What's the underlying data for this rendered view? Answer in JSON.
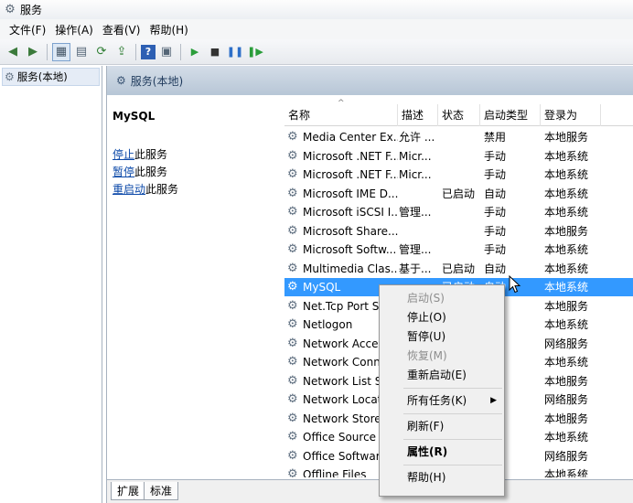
{
  "window": {
    "title": "服务"
  },
  "menubar": [
    {
      "name": "menu-file",
      "label": "文件(F)"
    },
    {
      "name": "menu-action",
      "label": "操作(A)"
    },
    {
      "name": "menu-view",
      "label": "查看(V)"
    },
    {
      "name": "menu-help",
      "label": "帮助(H)"
    }
  ],
  "tree": {
    "root": "服务(本地)"
  },
  "main": {
    "header": "服务(本地)",
    "selected_service": "MySQL",
    "actions": [
      {
        "link": "停止",
        "rest": "此服务"
      },
      {
        "link": "暂停",
        "rest": "此服务"
      },
      {
        "link": "重启动",
        "rest": "此服务"
      }
    ],
    "columns": [
      "名称",
      "描述",
      "状态",
      "启动类型",
      "登录为"
    ],
    "rows": [
      {
        "name": "Media Center Ex...",
        "desc": "允许 ...",
        "status": "",
        "startup": "禁用",
        "logon": "本地服务"
      },
      {
        "name": "Microsoft .NET F...",
        "desc": "Micr...",
        "status": "",
        "startup": "手动",
        "logon": "本地系统"
      },
      {
        "name": "Microsoft .NET F...",
        "desc": "Micr...",
        "status": "",
        "startup": "手动",
        "logon": "本地系统"
      },
      {
        "name": "Microsoft IME D...",
        "desc": "",
        "status": "已启动",
        "startup": "自动",
        "logon": "本地系统"
      },
      {
        "name": "Microsoft iSCSI I...",
        "desc": "管理...",
        "status": "",
        "startup": "手动",
        "logon": "本地系统"
      },
      {
        "name": "Microsoft Share...",
        "desc": "",
        "status": "",
        "startup": "手动",
        "logon": "本地服务"
      },
      {
        "name": "Microsoft Softw...",
        "desc": "管理...",
        "status": "",
        "startup": "手动",
        "logon": "本地系统"
      },
      {
        "name": "Multimedia Clas...",
        "desc": "基于...",
        "status": "已启动",
        "startup": "自动",
        "logon": "本地系统"
      },
      {
        "name": "MySQL",
        "desc": "",
        "status": "已启动",
        "startup": "自动",
        "logon": "本地系统"
      },
      {
        "name": "Net.Tcp Port Sh",
        "desc": "",
        "status": "",
        "startup": "",
        "logon": "本地服务"
      },
      {
        "name": "Netlogon",
        "desc": "",
        "status": "",
        "startup": "",
        "logon": "本地系统"
      },
      {
        "name": "Network Access",
        "desc": "",
        "status": "",
        "startup": "",
        "logon": "网络服务"
      },
      {
        "name": "Network Conne",
        "desc": "",
        "status": "",
        "startup": "",
        "logon": "本地系统"
      },
      {
        "name": "Network List Se",
        "desc": "",
        "status": "",
        "startup": "",
        "logon": "本地服务"
      },
      {
        "name": "Network Locati",
        "desc": "",
        "status": "",
        "startup": "",
        "logon": "网络服务"
      },
      {
        "name": "Network Store",
        "desc": "",
        "status": "",
        "startup": "",
        "logon": "本地服务"
      },
      {
        "name": "Office  Source",
        "desc": "",
        "status": "",
        "startup": "",
        "logon": "本地系统"
      },
      {
        "name": "Office Software",
        "desc": "",
        "status": "",
        "startup": "",
        "logon": "网络服务"
      },
      {
        "name": "Offline Files",
        "desc": "",
        "status": "",
        "startup": "",
        "logon": "本地系统"
      }
    ],
    "selected_row_index": 8,
    "tabs": [
      "扩展",
      "标准"
    ]
  },
  "context_menu": {
    "items": [
      {
        "label": "启动(S)",
        "disabled": true
      },
      {
        "label": "停止(O)"
      },
      {
        "label": "暂停(U)"
      },
      {
        "label": "恢复(M)",
        "disabled": true
      },
      {
        "label": "重新启动(E)"
      },
      {
        "separator": true
      },
      {
        "label": "所有任务(K)",
        "submenu": true
      },
      {
        "separator": true
      },
      {
        "label": "刷新(F)"
      },
      {
        "separator": true
      },
      {
        "label": "属性(R)",
        "bold": true
      },
      {
        "separator": true
      },
      {
        "label": "帮助(H)"
      }
    ]
  },
  "colors": {
    "selection": "#3399ff",
    "link": "#0b48a8",
    "header_band": "#b7c6d6"
  },
  "icons": {
    "toolbar": [
      "back-arrow-icon",
      "forward-arrow-icon",
      "show-hide-tree-icon",
      "properties-sheet-icon",
      "refresh-icon",
      "export-list-icon",
      "help-icon",
      "view-icon",
      "start-service-icon",
      "stop-service-icon",
      "pause-service-icon",
      "restart-service-icon"
    ],
    "service": "service-gear-icon"
  }
}
